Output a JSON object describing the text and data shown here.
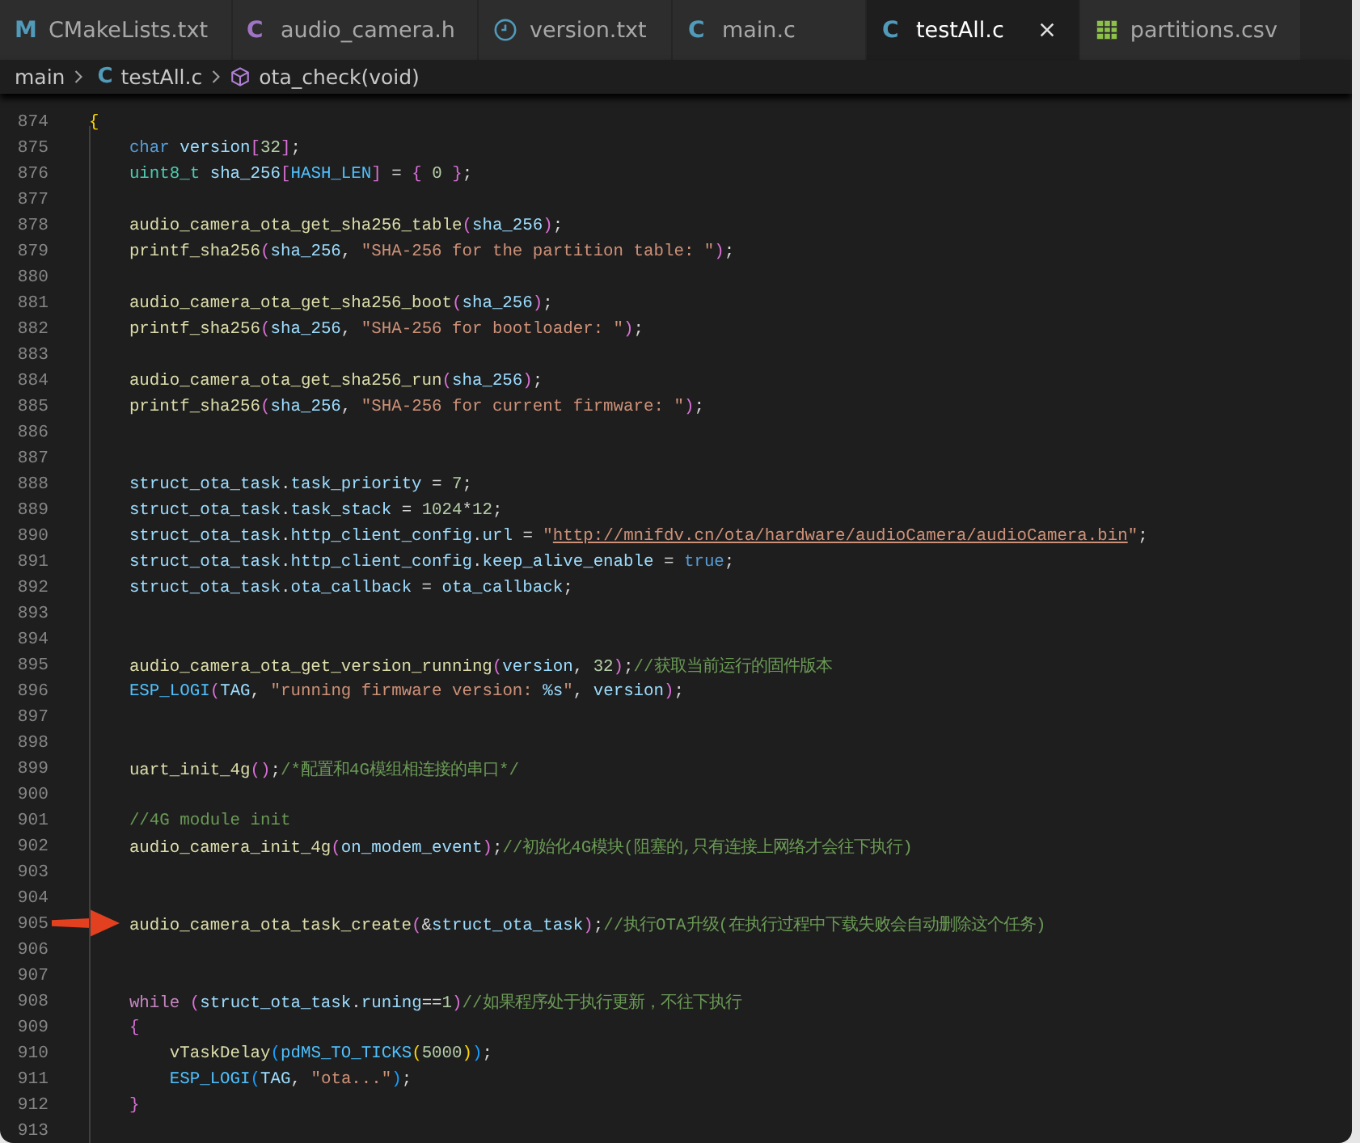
{
  "tabs": [
    {
      "label": "CMakeLists.txt",
      "icon": {
        "kind": "letter",
        "text": "M",
        "color": "#519aba"
      },
      "selected": false
    },
    {
      "label": "audio_camera.h",
      "icon": {
        "kind": "letter",
        "text": "C",
        "color": "#a074c4"
      },
      "selected": false
    },
    {
      "label": "version.txt",
      "icon": {
        "kind": "clock",
        "color": "#519aba"
      },
      "selected": false
    },
    {
      "label": "main.c",
      "icon": {
        "kind": "letter",
        "text": "C",
        "color": "#519aba"
      },
      "selected": false
    },
    {
      "label": "testAll.c",
      "icon": {
        "kind": "letter",
        "text": "C",
        "color": "#519aba"
      },
      "selected": true
    },
    {
      "label": "partitions.csv",
      "icon": {
        "kind": "table",
        "color": "#8dc149"
      },
      "selected": false
    }
  ],
  "breadcrumb": [
    {
      "label": "main"
    },
    {
      "label": "testAll.c",
      "icon": {
        "kind": "letter",
        "text": "C",
        "color": "#519aba"
      }
    },
    {
      "label": "ota_check(void)",
      "icon": {
        "kind": "cube",
        "color": "#b180d7"
      }
    }
  ],
  "editor": {
    "lines": [
      {
        "number": "874",
        "marked": false,
        "tokens": [
          {
            "kind": "br1",
            "text": "{"
          }
        ]
      },
      {
        "number": "875",
        "marked": false,
        "tokens": [
          {
            "kind": "kw",
            "text": "    char"
          },
          {
            "kind": "var",
            "text": " version"
          },
          {
            "kind": "br2",
            "text": "["
          },
          {
            "kind": "num",
            "text": "32"
          },
          {
            "kind": "br2",
            "text": "]"
          },
          {
            "kind": "punc",
            "text": ";"
          }
        ]
      },
      {
        "number": "876",
        "marked": false,
        "tokens": [
          {
            "kind": "type",
            "text": "    uint8_t"
          },
          {
            "kind": "var",
            "text": " sha_256"
          },
          {
            "kind": "br2",
            "text": "["
          },
          {
            "kind": "macro",
            "text": "HASH_LEN"
          },
          {
            "kind": "br2",
            "text": "]"
          },
          {
            "kind": "punc",
            "text": " = "
          },
          {
            "kind": "br2",
            "text": "{"
          },
          {
            "kind": "num",
            "text": " 0"
          },
          {
            "kind": "br2",
            "text": " }"
          },
          {
            "kind": "punc",
            "text": ";"
          }
        ]
      },
      {
        "number": "877",
        "marked": false
      },
      {
        "number": "878",
        "marked": false,
        "tokens": [
          {
            "kind": "fn",
            "text": "    audio_camera_ota_get_sha256_table"
          },
          {
            "kind": "br2",
            "text": "("
          },
          {
            "kind": "var",
            "text": "sha_256"
          },
          {
            "kind": "br2",
            "text": ")"
          },
          {
            "kind": "punc",
            "text": ";"
          }
        ]
      },
      {
        "number": "879",
        "marked": false,
        "tokens": [
          {
            "kind": "fn",
            "text": "    printf_sha256"
          },
          {
            "kind": "br2",
            "text": "("
          },
          {
            "kind": "var",
            "text": "sha_256"
          },
          {
            "kind": "punc",
            "text": ", "
          },
          {
            "kind": "str",
            "text": "\"SHA-256 for the partition table: \""
          },
          {
            "kind": "br2",
            "text": ")"
          },
          {
            "kind": "punc",
            "text": ";"
          }
        ]
      },
      {
        "number": "880",
        "marked": false
      },
      {
        "number": "881",
        "marked": false,
        "tokens": [
          {
            "kind": "fn",
            "text": "    audio_camera_ota_get_sha256_boot"
          },
          {
            "kind": "br2",
            "text": "("
          },
          {
            "kind": "var",
            "text": "sha_256"
          },
          {
            "kind": "br2",
            "text": ")"
          },
          {
            "kind": "punc",
            "text": ";"
          }
        ]
      },
      {
        "number": "882",
        "marked": false,
        "tokens": [
          {
            "kind": "fn",
            "text": "    printf_sha256"
          },
          {
            "kind": "br2",
            "text": "("
          },
          {
            "kind": "var",
            "text": "sha_256"
          },
          {
            "kind": "punc",
            "text": ", "
          },
          {
            "kind": "str",
            "text": "\"SHA-256 for bootloader: \""
          },
          {
            "kind": "br2",
            "text": ")"
          },
          {
            "kind": "punc",
            "text": ";"
          }
        ]
      },
      {
        "number": "883",
        "marked": false
      },
      {
        "number": "884",
        "marked": false,
        "tokens": [
          {
            "kind": "fn",
            "text": "    audio_camera_ota_get_sha256_run"
          },
          {
            "kind": "br2",
            "text": "("
          },
          {
            "kind": "var",
            "text": "sha_256"
          },
          {
            "kind": "br2",
            "text": ")"
          },
          {
            "kind": "punc",
            "text": ";"
          }
        ]
      },
      {
        "number": "885",
        "marked": false,
        "tokens": [
          {
            "kind": "fn",
            "text": "    printf_sha256"
          },
          {
            "kind": "br2",
            "text": "("
          },
          {
            "kind": "var",
            "text": "sha_256"
          },
          {
            "kind": "punc",
            "text": ", "
          },
          {
            "kind": "str",
            "text": "\"SHA-256 for current firmware: \""
          },
          {
            "kind": "br2",
            "text": ")"
          },
          {
            "kind": "punc",
            "text": ";"
          }
        ]
      },
      {
        "number": "886",
        "marked": false
      },
      {
        "number": "887",
        "marked": false
      },
      {
        "number": "888",
        "marked": false,
        "tokens": [
          {
            "kind": "var",
            "text": "    struct_ota_task"
          },
          {
            "kind": "punc",
            "text": "."
          },
          {
            "kind": "var",
            "text": "task_priority"
          },
          {
            "kind": "punc",
            "text": " = "
          },
          {
            "kind": "num",
            "text": "7"
          },
          {
            "kind": "punc",
            "text": ";"
          }
        ]
      },
      {
        "number": "889",
        "marked": false,
        "tokens": [
          {
            "kind": "var",
            "text": "    struct_ota_task"
          },
          {
            "kind": "punc",
            "text": "."
          },
          {
            "kind": "var",
            "text": "task_stack"
          },
          {
            "kind": "punc",
            "text": " = "
          },
          {
            "kind": "num",
            "text": "1024"
          },
          {
            "kind": "punc",
            "text": "*"
          },
          {
            "kind": "num",
            "text": "12"
          },
          {
            "kind": "punc",
            "text": ";"
          }
        ]
      },
      {
        "number": "890",
        "marked": false,
        "tokens": [
          {
            "kind": "var",
            "text": "    struct_ota_task"
          },
          {
            "kind": "punc",
            "text": "."
          },
          {
            "kind": "var",
            "text": "http_client_config"
          },
          {
            "kind": "punc",
            "text": "."
          },
          {
            "kind": "var",
            "text": "url"
          },
          {
            "kind": "punc",
            "text": " = "
          },
          {
            "kind": "str",
            "text": "\""
          },
          {
            "kind": "url",
            "text": "http://mnifdv.cn/ota/hardware/audioCamera/audioCamera.bin"
          },
          {
            "kind": "str",
            "text": "\""
          },
          {
            "kind": "punc",
            "text": ";"
          }
        ]
      },
      {
        "number": "891",
        "marked": false,
        "tokens": [
          {
            "kind": "var",
            "text": "    struct_ota_task"
          },
          {
            "kind": "punc",
            "text": "."
          },
          {
            "kind": "var",
            "text": "http_client_config"
          },
          {
            "kind": "punc",
            "text": "."
          },
          {
            "kind": "var",
            "text": "keep_alive_enable"
          },
          {
            "kind": "punc",
            "text": " = "
          },
          {
            "kind": "kw",
            "text": "true"
          },
          {
            "kind": "punc",
            "text": ";"
          }
        ]
      },
      {
        "number": "892",
        "marked": false,
        "tokens": [
          {
            "kind": "var",
            "text": "    struct_ota_task"
          },
          {
            "kind": "punc",
            "text": "."
          },
          {
            "kind": "var",
            "text": "ota_callback"
          },
          {
            "kind": "punc",
            "text": " = "
          },
          {
            "kind": "var",
            "text": "ota_callback"
          },
          {
            "kind": "punc",
            "text": ";"
          }
        ]
      },
      {
        "number": "893",
        "marked": false
      },
      {
        "number": "894",
        "marked": false
      },
      {
        "number": "895",
        "marked": false,
        "tokens": [
          {
            "kind": "fn",
            "text": "    audio_camera_ota_get_version_running"
          },
          {
            "kind": "br2",
            "text": "("
          },
          {
            "kind": "var",
            "text": "version"
          },
          {
            "kind": "punc",
            "text": ", "
          },
          {
            "kind": "num",
            "text": "32"
          },
          {
            "kind": "br2",
            "text": ")"
          },
          {
            "kind": "punc",
            "text": ";"
          },
          {
            "kind": "com",
            "text": "//获取当前运行的固件版本"
          }
        ]
      },
      {
        "number": "896",
        "marked": false,
        "tokens": [
          {
            "kind": "macro",
            "text": "    ESP_LOGI"
          },
          {
            "kind": "br2",
            "text": "("
          },
          {
            "kind": "var",
            "text": "TAG"
          },
          {
            "kind": "punc",
            "text": ", "
          },
          {
            "kind": "str",
            "text": "\"running firmware version: "
          },
          {
            "kind": "fmt",
            "text": "%s"
          },
          {
            "kind": "str",
            "text": "\""
          },
          {
            "kind": "punc",
            "text": ", "
          },
          {
            "kind": "var",
            "text": "version"
          },
          {
            "kind": "br2",
            "text": ")"
          },
          {
            "kind": "punc",
            "text": ";"
          }
        ]
      },
      {
        "number": "897",
        "marked": false
      },
      {
        "number": "898",
        "marked": false
      },
      {
        "number": "899",
        "marked": false,
        "tokens": [
          {
            "kind": "fn",
            "text": "    uart_init_4g"
          },
          {
            "kind": "br2",
            "text": "()"
          },
          {
            "kind": "punc",
            "text": ";"
          },
          {
            "kind": "com",
            "text": "/*配置和4G模组相连接的串口*/"
          }
        ]
      },
      {
        "number": "900",
        "marked": false
      },
      {
        "number": "901",
        "marked": false,
        "tokens": [
          {
            "kind": "com",
            "text": "    //4G module init"
          }
        ]
      },
      {
        "number": "902",
        "marked": false,
        "tokens": [
          {
            "kind": "fn",
            "text": "    audio_camera_init_4g"
          },
          {
            "kind": "br2",
            "text": "("
          },
          {
            "kind": "var",
            "text": "on_modem_event"
          },
          {
            "kind": "br2",
            "text": ")"
          },
          {
            "kind": "punc",
            "text": ";"
          },
          {
            "kind": "com",
            "text": "//初始化4G模块(阻塞的,只有连接上网络才会往下执行)"
          }
        ]
      },
      {
        "number": "903",
        "marked": false
      },
      {
        "number": "904",
        "marked": false
      },
      {
        "number": "905",
        "marked": true,
        "tokens": [
          {
            "kind": "fn",
            "text": "    audio_camera_ota_task_create"
          },
          {
            "kind": "br2",
            "text": "("
          },
          {
            "kind": "punc",
            "text": "&"
          },
          {
            "kind": "var",
            "text": "struct_ota_task"
          },
          {
            "kind": "br2",
            "text": ")"
          },
          {
            "kind": "punc",
            "text": ";"
          },
          {
            "kind": "com",
            "text": "//执行OTA升级(在执行过程中下载失败会自动删除这个任务)"
          }
        ]
      },
      {
        "number": "906",
        "marked": false
      },
      {
        "number": "907",
        "marked": false
      },
      {
        "number": "908",
        "marked": false,
        "tokens": [
          {
            "kind": "ctl",
            "text": "    while"
          },
          {
            "kind": "br2",
            "text": " ("
          },
          {
            "kind": "var",
            "text": "struct_ota_task"
          },
          {
            "kind": "punc",
            "text": "."
          },
          {
            "kind": "var",
            "text": "runing"
          },
          {
            "kind": "punc",
            "text": "=="
          },
          {
            "kind": "num",
            "text": "1"
          },
          {
            "kind": "br2",
            "text": ")"
          },
          {
            "kind": "com",
            "text": "//如果程序处于执行更新，不往下执行"
          }
        ]
      },
      {
        "number": "909",
        "marked": false,
        "tokens": [
          {
            "kind": "br2",
            "text": "    {"
          }
        ]
      },
      {
        "number": "910",
        "marked": false,
        "tokens": [
          {
            "kind": "fn",
            "text": "        vTaskDelay"
          },
          {
            "kind": "br3",
            "text": "("
          },
          {
            "kind": "macro",
            "text": "pdMS_TO_TICKS"
          },
          {
            "kind": "br1",
            "text": "("
          },
          {
            "kind": "num",
            "text": "5000"
          },
          {
            "kind": "br1",
            "text": ")"
          },
          {
            "kind": "br3",
            "text": ")"
          },
          {
            "kind": "punc",
            "text": ";"
          }
        ]
      },
      {
        "number": "911",
        "marked": false,
        "tokens": [
          {
            "kind": "macro",
            "text": "        ESP_LOGI"
          },
          {
            "kind": "br3",
            "text": "("
          },
          {
            "kind": "var",
            "text": "TAG"
          },
          {
            "kind": "punc",
            "text": ", "
          },
          {
            "kind": "str",
            "text": "\"ota...\""
          },
          {
            "kind": "br3",
            "text": ")"
          },
          {
            "kind": "punc",
            "text": ";"
          }
        ]
      },
      {
        "number": "912",
        "marked": false,
        "tokens": [
          {
            "kind": "br2",
            "text": "    }"
          }
        ]
      },
      {
        "number": "913",
        "marked": false
      }
    ]
  }
}
